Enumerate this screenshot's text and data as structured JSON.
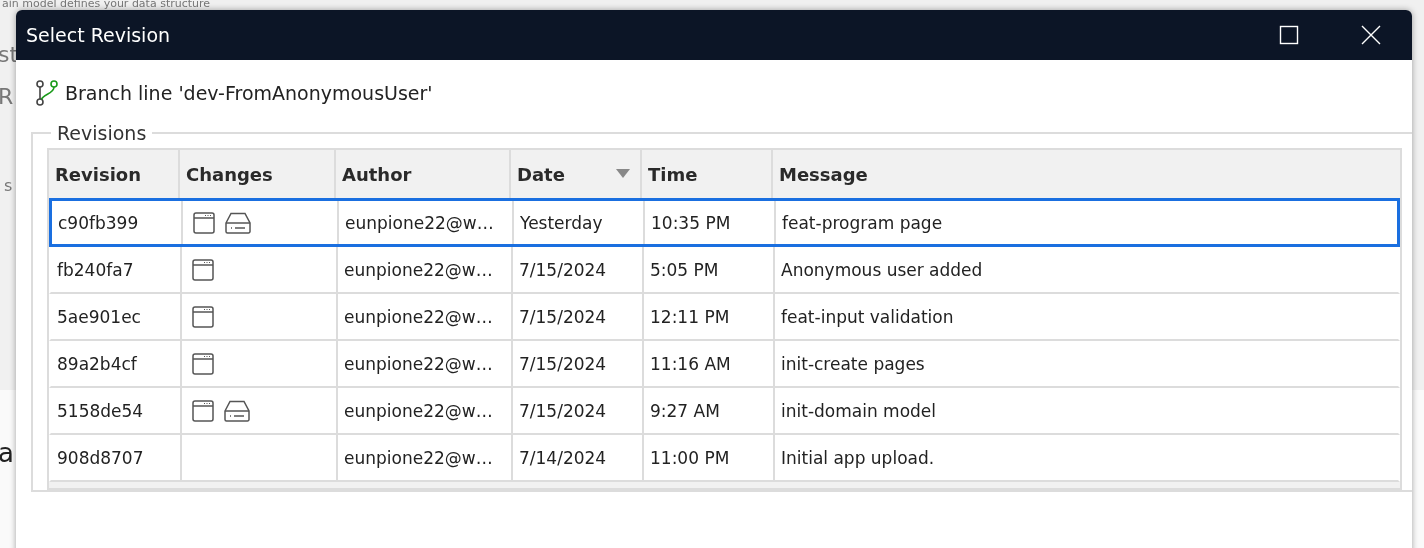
{
  "background": {
    "texts": [
      "ain model defines your data structure",
      "st",
      "R",
      "s",
      "a"
    ]
  },
  "window": {
    "title": "Select Revision"
  },
  "branch": {
    "label": "Branch line 'dev-FromAnonymousUser'"
  },
  "revisions": {
    "legend": "Revisions",
    "columns": [
      {
        "label": "Revision"
      },
      {
        "label": "Changes"
      },
      {
        "label": "Author"
      },
      {
        "label": "Date",
        "sorted": true
      },
      {
        "label": "Time"
      },
      {
        "label": "Message"
      }
    ],
    "rows": [
      {
        "revision": "c90fb399",
        "changes": [
          {
            "kind": "window"
          },
          {
            "kind": "drive"
          }
        ],
        "author": "eunpione22@w…",
        "date": "Yesterday",
        "time": "10:35 PM",
        "message": "feat-program page",
        "selected": true
      },
      {
        "revision": "fb240fa7",
        "changes": [
          {
            "kind": "window"
          }
        ],
        "author": "eunpione22@w…",
        "date": "7/15/2024",
        "time": "5:05 PM",
        "message": "Anonymous user added",
        "selected": false
      },
      {
        "revision": "5ae901ec",
        "changes": [
          {
            "kind": "window"
          }
        ],
        "author": "eunpione22@w…",
        "date": "7/15/2024",
        "time": "12:11 PM",
        "message": "feat-input validation",
        "selected": false
      },
      {
        "revision": "89a2b4cf",
        "changes": [
          {
            "kind": "window"
          }
        ],
        "author": "eunpione22@w…",
        "date": "7/15/2024",
        "time": "11:16 AM",
        "message": "init-create pages",
        "selected": false
      },
      {
        "revision": "5158de54",
        "changes": [
          {
            "kind": "window"
          },
          {
            "kind": "drive"
          }
        ],
        "author": "eunpione22@w…",
        "date": "7/15/2024",
        "time": "9:27 AM",
        "message": "init-domain model",
        "selected": false
      },
      {
        "revision": "908d8707",
        "changes": [],
        "author": "eunpione22@w…",
        "date": "7/14/2024",
        "time": "11:00 PM",
        "message": "Initial app upload.",
        "selected": false
      }
    ]
  }
}
